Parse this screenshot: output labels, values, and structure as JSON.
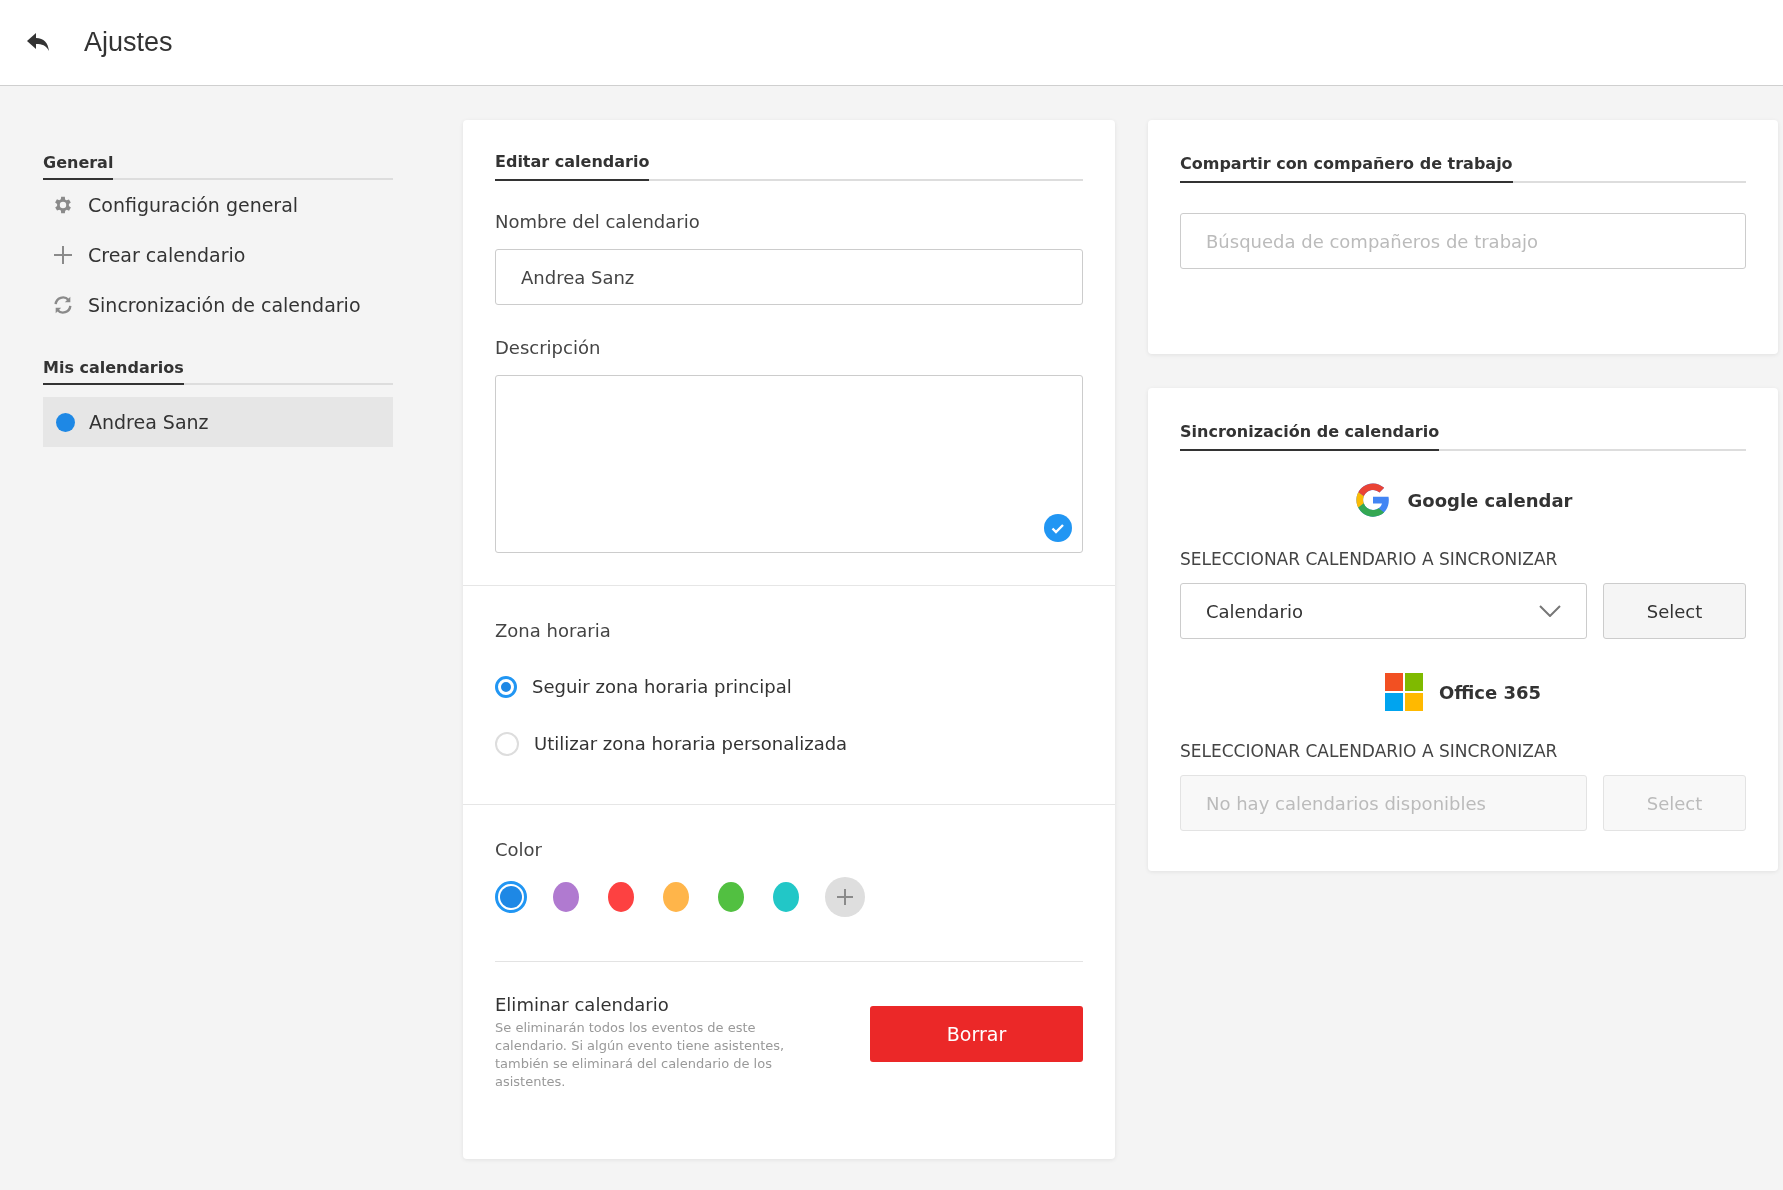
{
  "header": {
    "title": "Ajustes"
  },
  "sidebar": {
    "general": {
      "title": "General",
      "items": [
        {
          "kind": "gear",
          "label": "Configuración general"
        },
        {
          "kind": "plus",
          "label": "Crear calendario"
        },
        {
          "kind": "sync",
          "label": "Sincronización de calendario"
        }
      ]
    },
    "my_calendars": {
      "title": "Mis calendarios",
      "items": [
        {
          "name": "Andrea Sanz",
          "color": "#1e88e5",
          "selected": true
        }
      ]
    }
  },
  "edit_card": {
    "title": "Editar calendario",
    "name_field": {
      "label": "Nombre del calendario",
      "value": "Andrea Sanz"
    },
    "description_field": {
      "label": "Descripción"
    },
    "timezone": {
      "label": "Zona horaria",
      "options": [
        {
          "label": "Seguir zona horaria principal",
          "selected": true
        },
        {
          "label": "Utilizar zona horaria personalizada",
          "selected": false
        }
      ]
    },
    "color": {
      "label": "Color",
      "swatches": [
        {
          "color": "#1e88e5",
          "selected": true
        },
        {
          "color": "#b07ad0",
          "selected": false
        },
        {
          "color": "#fd4141",
          "selected": false
        },
        {
          "color": "#ffb54a",
          "selected": false
        },
        {
          "color": "#52c041",
          "selected": false
        },
        {
          "color": "#22c7c7",
          "selected": false
        }
      ]
    },
    "delete": {
      "title": "Eliminar calendario",
      "text": "Se eliminarán todos los eventos de este calendario. Si algún evento tiene asistentes, también se eliminará del calendario de los asistentes.",
      "button": "Borrar"
    }
  },
  "share_card": {
    "title": "Compartir con compañero de trabajo",
    "search": {
      "placeholder": "Búsqueda de compañeros de trabajo"
    }
  },
  "sync_card": {
    "title": "Sincronización de calendario",
    "providers": [
      {
        "kind": "google",
        "name": "Google calendar",
        "select_label": "SELECCIONAR CALENDARIO A SINCRONIZAR",
        "dropdown": {
          "value": "Calendario",
          "disabled": false
        },
        "button": {
          "label": "Select",
          "disabled": false
        }
      },
      {
        "kind": "microsoft",
        "name": "Office 365",
        "select_label": "SELECCIONAR CALENDARIO A SINCRONIZAR",
        "dropdown": {
          "value": "No hay calendarios disponibles",
          "disabled": true
        },
        "button": {
          "label": "Select",
          "disabled": true
        }
      }
    ]
  }
}
